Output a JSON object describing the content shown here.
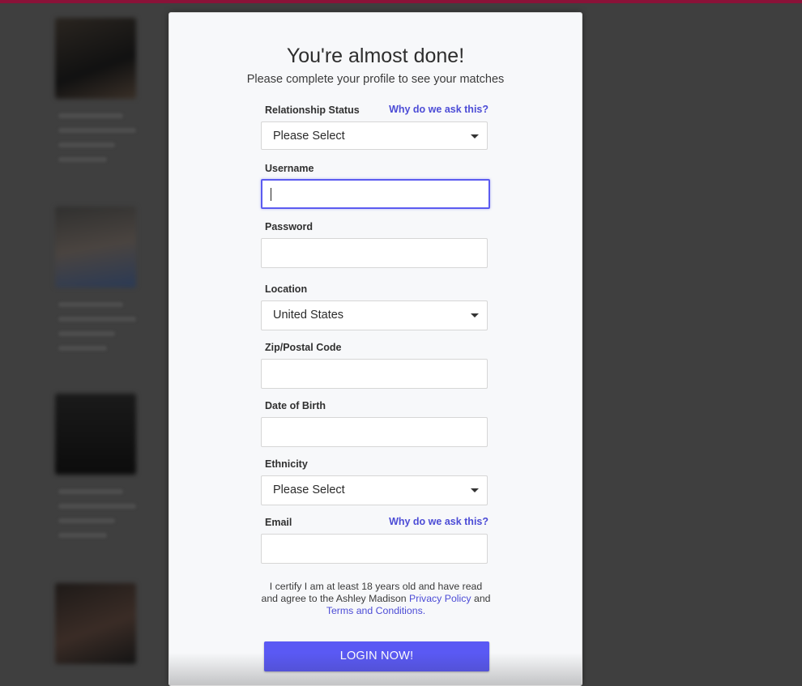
{
  "colors": {
    "accent": "#5a59f4",
    "link": "#4c4cd6",
    "top_bar": "#8a1238",
    "overlay": "#3f3f3f"
  },
  "modal": {
    "title": "You're almost done!",
    "subtitle": "Please complete your profile to see your matches",
    "fields": {
      "relationship_status": {
        "label": "Relationship Status",
        "help_link": "Why do we ask this?",
        "value": "Please Select"
      },
      "username": {
        "label": "Username",
        "value": ""
      },
      "password": {
        "label": "Password",
        "value": ""
      },
      "location": {
        "label": "Location",
        "value": "United States"
      },
      "zip": {
        "label": "Zip/Postal Code",
        "value": ""
      },
      "dob": {
        "label": "Date of Birth",
        "value": ""
      },
      "ethnicity": {
        "label": "Ethnicity",
        "value": "Please Select"
      },
      "email": {
        "label": "Email",
        "help_link": "Why do we ask this?",
        "value": ""
      }
    },
    "certify": {
      "line1": "I certify I am at least 18 years old and have read",
      "line2_prefix": "and agree to the Ashley Madison",
      "privacy_link": "Privacy Policy",
      "line2_suffix": "and",
      "terms_link": "Terms and Conditions."
    },
    "submit_label": "LOGIN NOW!"
  }
}
